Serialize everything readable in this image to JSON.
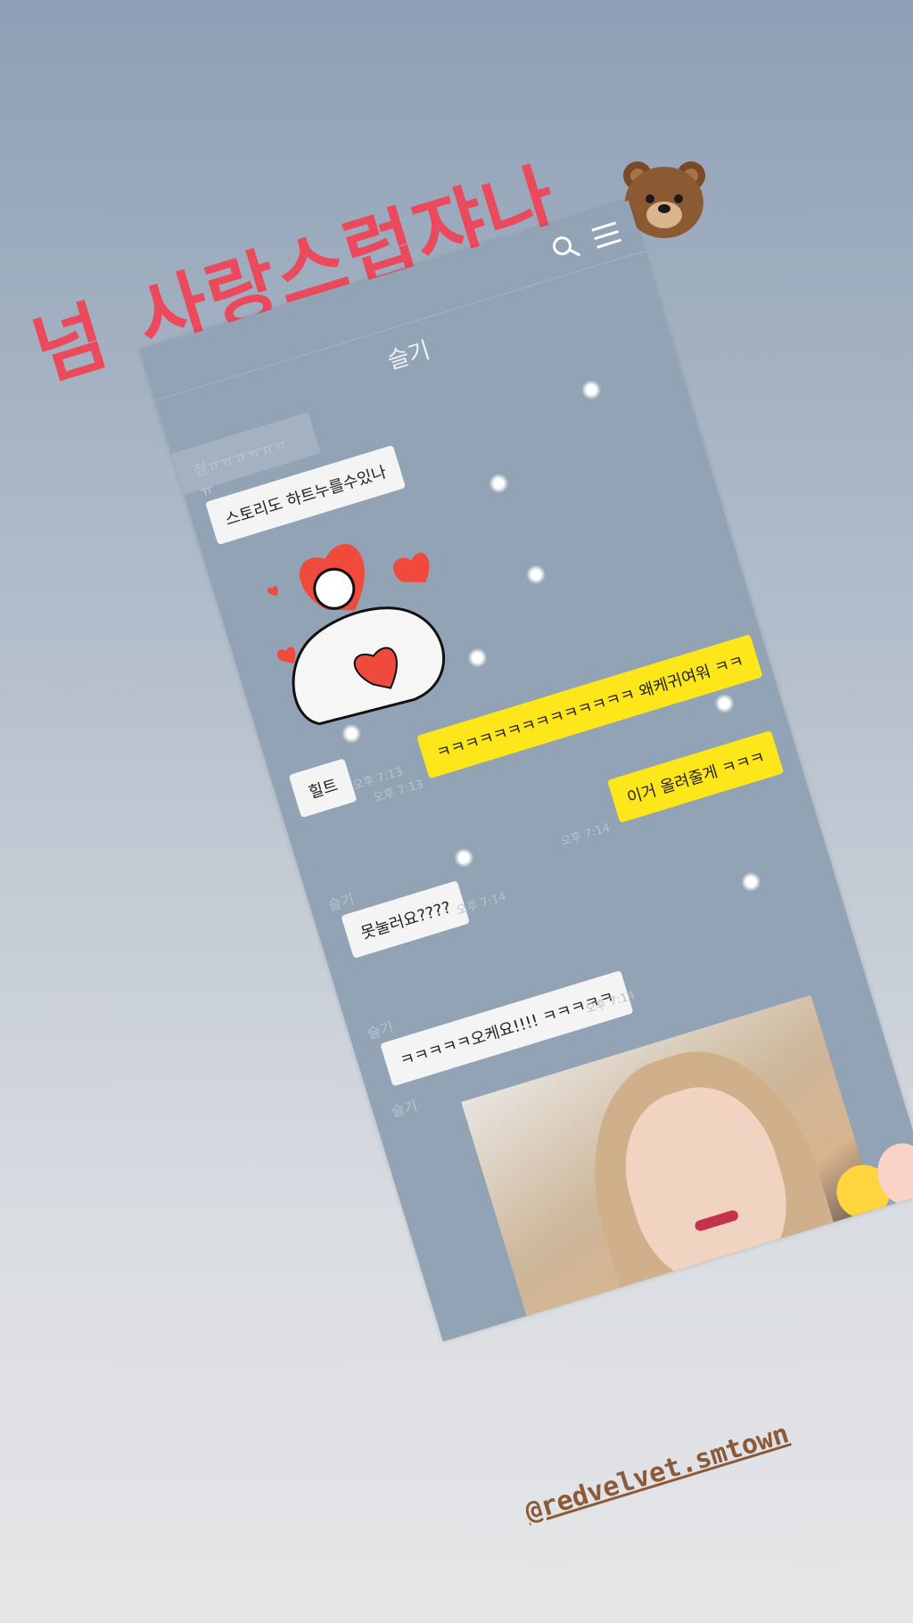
{
  "story": {
    "caption_word1": "넘",
    "caption_word2": "사랑스럽쟈나",
    "emoji": "bear-face",
    "mention": "@redvelvet.smtown",
    "caption_color": "#ea4a5c"
  },
  "chat": {
    "title": "슬기",
    "preview": "첨ㅠㅠㅠㅠㅠㅠㅠ",
    "messages": [
      {
        "from": "other",
        "text": "스토리도 하트누를수있나"
      },
      {
        "from": "other",
        "type": "sticker"
      },
      {
        "from": "other",
        "text": "힐트",
        "time": "오후 7:13"
      },
      {
        "from": "me",
        "text": "ㅋㅋㅋㅋㅋㅋㅋㅋㅋㅋㅋㅋㅋㅋ 왜케귀여워 ㅋㅋ",
        "time": "오후 7:13"
      },
      {
        "from": "me",
        "text": "이거 올려줄게 ㅋㅋㅋ",
        "time": "오후 7:14"
      },
      {
        "from": "other",
        "sender": "슬기",
        "text": "못눌러요????",
        "time": "오후 7:14"
      },
      {
        "from": "other",
        "sender": "슬기",
        "text": "ㅋㅋㅋㅋㅋ오케요!!!! ㅋㅋㅋㅋㅋ",
        "time": "오후 7:14"
      },
      {
        "from": "other",
        "sender": "슬기",
        "type": "photo"
      }
    ],
    "colors": {
      "background": "#93a3b6",
      "my_bubble": "#fde61a",
      "their_bubble": "#f4f4f4"
    }
  }
}
